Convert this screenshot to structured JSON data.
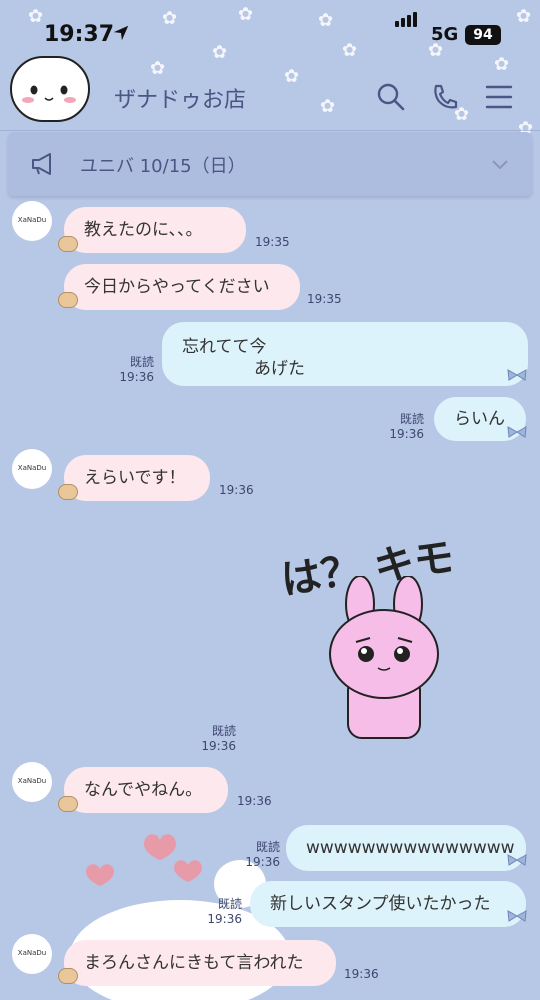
{
  "status_bar": {
    "time": "19:37",
    "network": "5G",
    "battery": "94"
  },
  "header": {
    "title": "ザナドゥお店"
  },
  "announcement": {
    "text": "ユニバ 10/15（日）"
  },
  "avatar_logo": "XaNaDu",
  "messages": [
    {
      "text": "教えたのに、、。",
      "time": "19:35"
    },
    {
      "text": "今日からやってください",
      "time": "19:35"
    },
    {
      "line1": "忘れてて今",
      "line2": "あげた",
      "read": "既読",
      "time": "19:36"
    },
    {
      "text": "らいん",
      "read": "既読",
      "time": "19:36"
    },
    {
      "text": "えらいです！",
      "time": "19:36"
    },
    {
      "sticker_text": "は？ キモ",
      "read": "既読",
      "time": "19:36"
    },
    {
      "text": "なんでやねん。",
      "time": "19:36"
    },
    {
      "text": "wwwwwwwwwwwwwww",
      "read": "既読",
      "time": "19:36"
    },
    {
      "text": "新しいスタンプ使いたかった",
      "read": "既読",
      "time": "19:36"
    },
    {
      "text": "まろんさんにきもて言われた",
      "time": "19:36"
    }
  ],
  "colors": {
    "background": "#b7c7e6",
    "incoming": "#fde8ee",
    "outgoing": "#ddf3fb",
    "accent": "#4a5784"
  }
}
